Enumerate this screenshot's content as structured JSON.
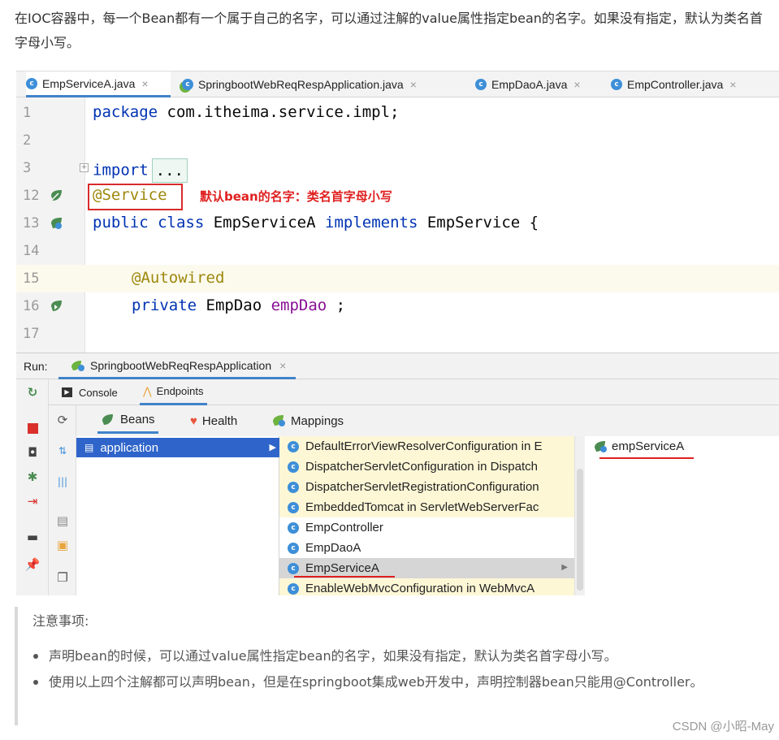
{
  "intro_text": "在IOC容器中，每一个Bean都有一个属于自己的名字，可以通过注解的value属性指定bean的名字。如果没有指定，默认为类名首字母小写。",
  "editor_tabs": [
    {
      "label": "EmpServiceA.java",
      "close": "×"
    },
    {
      "label": "SpringbootWebReqRespApplication.java",
      "close": "×"
    },
    {
      "label": "EmpDaoA.java",
      "close": "×"
    },
    {
      "label": "EmpController.java",
      "close": "×"
    }
  ],
  "code": {
    "l1": {
      "num": "1",
      "kw": "package",
      "rest": " com.itheima.service.impl;"
    },
    "l2": {
      "num": "2"
    },
    "l3": {
      "num": "3",
      "kw": "import",
      "dots": "..."
    },
    "l12": {
      "num": "12",
      "ann": "@Service"
    },
    "l13": {
      "num": "13",
      "kw1": "public class",
      "name": " EmpServiceA ",
      "kw2": "implements",
      "rest": " EmpService {"
    },
    "l14": {
      "num": "14"
    },
    "l15": {
      "num": "15",
      "ann": "@Autowired"
    },
    "l16": {
      "num": "16",
      "kw": "private",
      "type": " EmpDao ",
      "field": "empDao",
      "rest": " ;"
    },
    "l17": {
      "num": "17"
    }
  },
  "annotation_note": "默认bean的名字：类名首字母小写",
  "run": {
    "label": "Run:",
    "tab": "SpringbootWebReqRespApplication",
    "close": "×",
    "sub_tabs": [
      "Console",
      "Endpoints"
    ],
    "endpoint_tabs": [
      "Beans",
      "Health",
      "Mappings"
    ],
    "context": "application",
    "beans": [
      "DefaultErrorViewResolverConfiguration in E",
      "DispatcherServletConfiguration in Dispatch",
      "DispatcherServletRegistrationConfiguration",
      "EmbeddedTomcat in ServletWebServerFac",
      "EmpController",
      "EmpDaoA",
      "EmpServiceA",
      "EnableWebMvcConfiguration in WebMvcA"
    ],
    "detail": "empServiceA"
  },
  "note": {
    "title": "注意事项:",
    "items": [
      "声明bean的时候，可以通过value属性指定bean的名字，如果没有指定，默认为类名首字母小写。",
      "使用以上四个注解都可以声明bean，但是在springboot集成web开发中，声明控制器bean只能用@Controller。"
    ]
  },
  "watermark": "CSDN @小昭-May",
  "colors": {
    "keyword": "#0033b3",
    "annotation": "#9e880d",
    "field": "#871094",
    "accent": "#4083c9",
    "selection": "#2f65ca",
    "highlight_red": "#e01f1f"
  }
}
